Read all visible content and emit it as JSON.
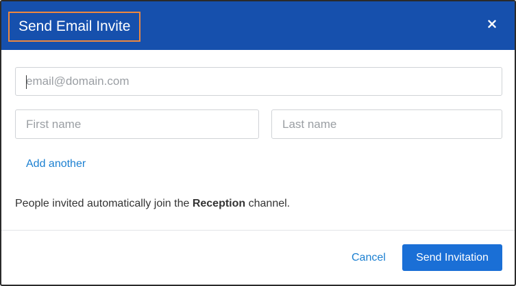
{
  "modal": {
    "title": "Send Email Invite",
    "close_icon": "close-icon"
  },
  "form": {
    "email_placeholder": "email@domain.com",
    "email_value": "",
    "first_name_placeholder": "First name",
    "first_name_value": "",
    "last_name_placeholder": "Last name",
    "last_name_value": "",
    "add_another_label": "Add another"
  },
  "info": {
    "prefix": "People invited automatically join the ",
    "channel": "Reception",
    "suffix": " channel."
  },
  "footer": {
    "cancel_label": "Cancel",
    "send_label": "Send Invitation"
  },
  "colors": {
    "header": "#1650ad",
    "title_highlight": "#f0883e",
    "link": "#1a7fd1",
    "primary_button": "#1a6fd6"
  }
}
